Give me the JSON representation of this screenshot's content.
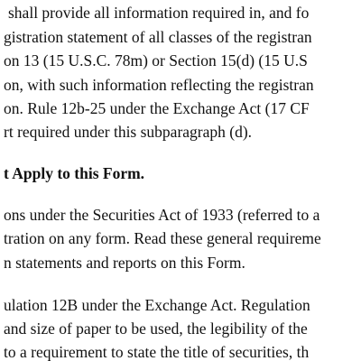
{
  "paragraph_1": {
    "lines": [
      "shall provide all information required in, and fo",
      "gistration statement of all classes of the registran",
      "on 13 (15 U.S.C. 78m) or Section 15(d) (15 U.S",
      "on, with such information reflecting the registran",
      "on. Rule 12b-25 under the Exchange Act (17 CF",
      "rt required under this subparagraph (d)."
    ]
  },
  "heading": {
    "text": "t Apply to this Form."
  },
  "paragraph_2": {
    "lines": [
      "ons under the Securities Act of 1933 (referred to a",
      "tration on any form. Read these general requireme",
      "n statements and reports on this Form."
    ]
  },
  "paragraph_3": {
    "lines": [
      "ulation 12B under the Exchange Act. Regulation",
      "and size of paper to be used, the legibility of the",
      "to a requirement to state the title of securities, th"
    ]
  }
}
